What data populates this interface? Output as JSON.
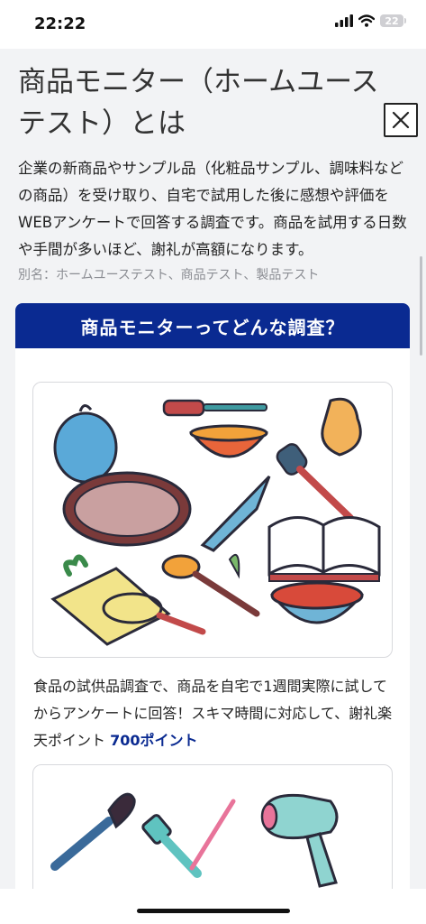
{
  "status_bar": {
    "time": "22:22",
    "battery": "22"
  },
  "modal": {
    "title": "商品モニター（ホームユーステスト）とは",
    "close_label": "×",
    "description": "企業の新商品やサンプル品（化粧品サンプル、調味料などの商品）を受け取り、自宅で試用した後に感想や評価をWEBアンケートで回答する調査です。商品を試用する日数や手間が多いほど、謝礼が高額になります。",
    "aliases": "別名：ホームユーステスト、商品テスト、製品テスト"
  },
  "card": {
    "heading": "商品モニターってどんな調査？",
    "items": [
      {
        "illustration": "kitchen-utensils",
        "text": "食品の試供品調査で、商品を自宅で1週間実際に試してからアンケートに回答！スキマ時間に対応して、謝礼楽天ポイント ",
        "reward": "700ポイント"
      },
      {
        "illustration": "beauty-tools"
      }
    ]
  },
  "colors": {
    "accent": "#0a2a91",
    "background": "#f2f3f5"
  }
}
